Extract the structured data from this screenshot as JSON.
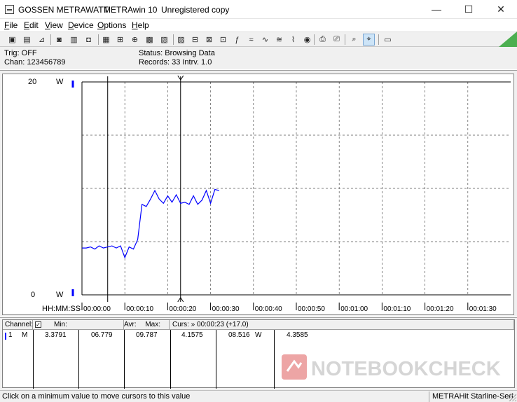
{
  "window": {
    "brand": "GOSSEN METRAWATT",
    "app_title": "METRAwin 10",
    "license": "Unregistered copy",
    "minimize": "—",
    "maximize": "☐",
    "close": "✕"
  },
  "menu": [
    "File",
    "Edit",
    "View",
    "Device",
    "Options",
    "Help"
  ],
  "toolbar_icons": [
    "save-icon",
    "save-as-icon",
    "open-icon",
    "record-icon",
    "device-icon",
    "table-icon",
    "scale-icon",
    "zoom-icon",
    "grid-icon",
    "config-icon",
    "chart-icon",
    "monitor-icon",
    "formula-icon",
    "signal-icon",
    "wave-icon",
    "filter-icon",
    "trigger-icon",
    "print-icon",
    "printer-icon",
    "zoom-plus-icon",
    "zoom-fit-icon",
    "message-icon"
  ],
  "info": {
    "trig": "Trig: OFF",
    "chan": "Chan:  123456789",
    "status": "Status:  Browsing Data",
    "records": "Records: 33  Intrv. 1.0"
  },
  "graph": {
    "y_top_label": "20",
    "y_bottom_label": "0",
    "unit_top": "W",
    "unit_bottom": "W",
    "x_axis_title": "HH:MM:SS"
  },
  "chart_data": {
    "type": "line",
    "x_tick_labels": [
      "00:00:00",
      "00:00:10",
      "00:00:20",
      "00:00:30",
      "00:00:40",
      "00:00:50",
      "00:01:00",
      "00:01:10",
      "00:01:20",
      "00:01:30"
    ],
    "ylim": [
      0,
      20
    ],
    "xlim_seconds": [
      0,
      100
    ],
    "grid": true,
    "cursor_seconds": [
      6,
      23
    ],
    "series": [
      {
        "color": "#0000ff",
        "x": [
          0,
          1,
          2,
          3,
          4,
          5,
          6,
          7,
          8,
          9,
          10,
          11,
          12,
          13,
          14,
          15,
          16,
          17,
          18,
          19,
          20,
          21,
          22,
          23,
          24,
          25,
          26,
          27,
          28,
          29,
          30,
          31,
          32
        ],
        "y": [
          4.4,
          4.4,
          4.5,
          4.3,
          4.6,
          4.4,
          4.5,
          4.6,
          4.4,
          4.6,
          3.5,
          4.5,
          4.3,
          5.2,
          8.5,
          8.3,
          9.0,
          9.8,
          9.0,
          8.6,
          9.3,
          8.7,
          9.4,
          8.6,
          8.7,
          8.5,
          9.3,
          8.5,
          8.9,
          9.8,
          8.6,
          9.9,
          9.8
        ]
      }
    ]
  },
  "table": {
    "headers": {
      "channel": "Channel:",
      "min": "Min:",
      "avr": "Avr:",
      "max": "Max:",
      "curs": "Curs: » 00:00:23 (+17.0)"
    },
    "row": {
      "channel_no": "1",
      "mode": "M",
      "min": "3.3791",
      "avr": "06.779",
      "max": "09.787",
      "curs1": "4.1575",
      "curs2": "08.516",
      "unit": "W",
      "curs3": "4.3585"
    }
  },
  "watermark": "NOTEBOOKCHECK",
  "status": {
    "hint": "Click on a minimum value to move cursors to this value",
    "device": "METRAHit Starline-Seri"
  }
}
